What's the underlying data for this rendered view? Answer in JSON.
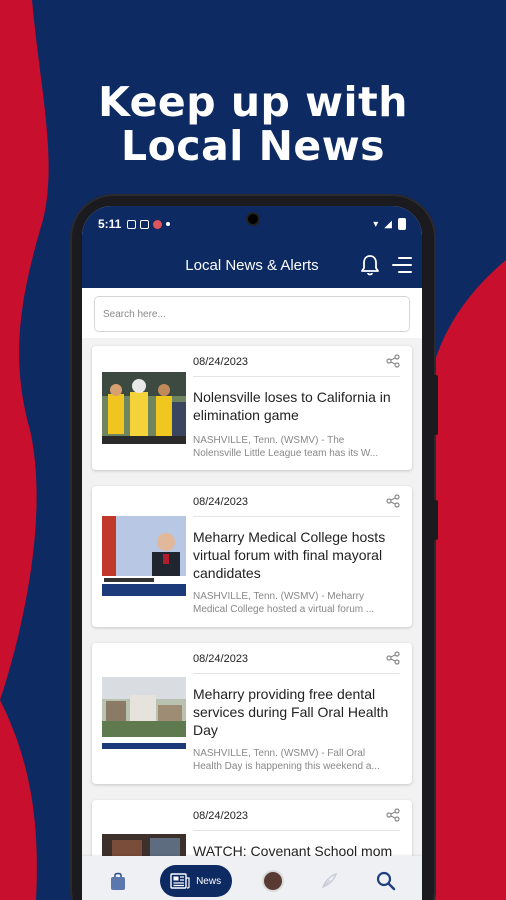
{
  "promo": {
    "line1": "Keep up with",
    "line2": "Local News"
  },
  "status": {
    "time": "5:11"
  },
  "appbar": {
    "title": "Local News & Alerts"
  },
  "search": {
    "placeholder": "Search here..."
  },
  "articles": [
    {
      "date": "08/24/2023",
      "title": "Nolensville loses to California in elimination game",
      "summary_l1": "NASHVILLE, Tenn. (WSMV) - The",
      "summary_l2": "Nolensville Little League team has its W..."
    },
    {
      "date": "08/24/2023",
      "title": "Meharry Medical College hosts virtual forum with final mayoral candidates",
      "summary_l1": "NASHVILLE, Tenn. (WSMV) - Meharry",
      "summary_l2": "Medical College hosted a virtual forum ..."
    },
    {
      "date": "08/24/2023",
      "title": "Meharry providing free dental services during Fall Oral Health Day",
      "summary_l1": "NASHVILLE, Tenn. (WSMV) - Fall Oral",
      "summary_l2": "Health Day is happening this weekend a..."
    },
    {
      "date": "08/24/2023",
      "title": "WATCH: Covenant School mom"
    }
  ],
  "bottomnav": {
    "news_label": "News"
  },
  "colors": {
    "navy": "#0d2a63",
    "red": "#c8102e"
  }
}
